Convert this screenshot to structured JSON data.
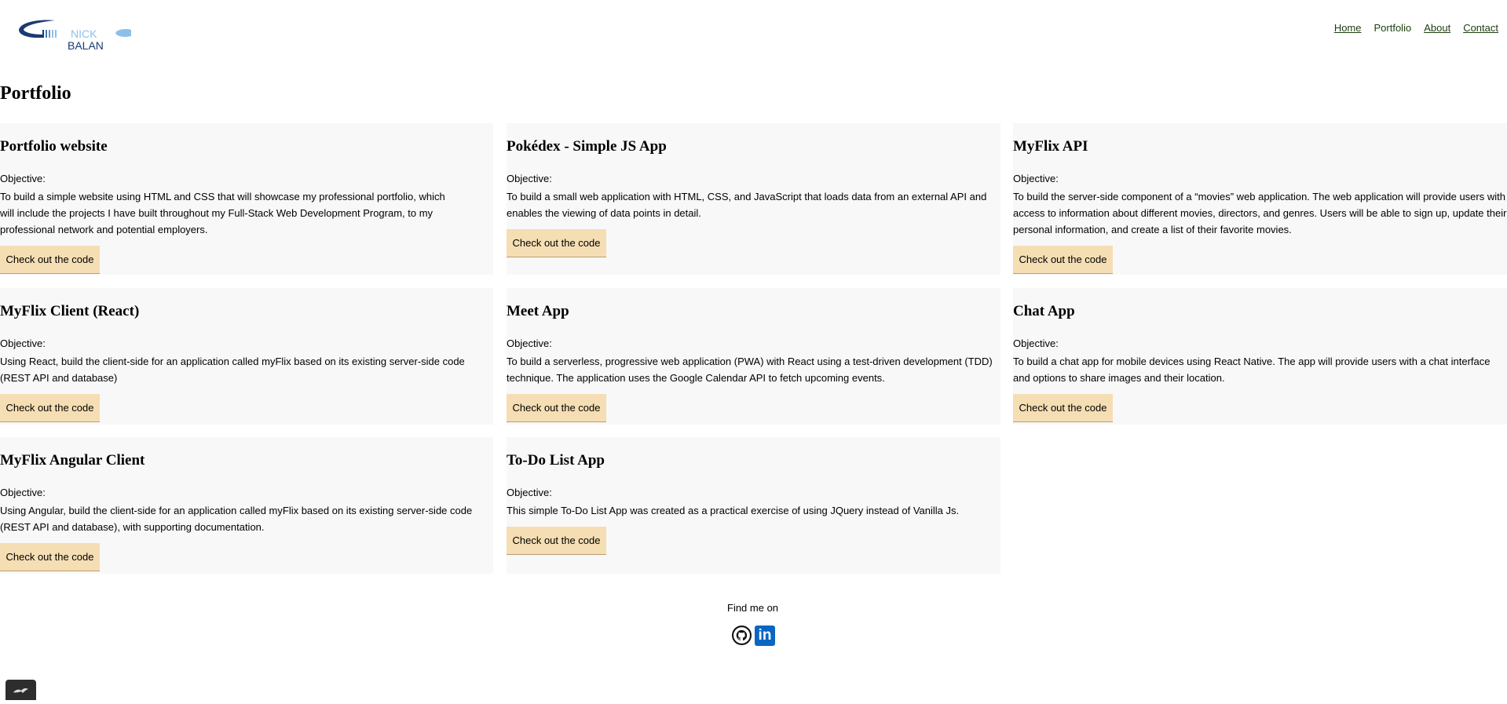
{
  "brand": {
    "first_name": "NICK",
    "last_name": "BALAN",
    "colors": {
      "navy": "#1a3a73",
      "light_blue": "#8cc0ea"
    }
  },
  "nav": {
    "items": [
      {
        "label": "Home",
        "active": false
      },
      {
        "label": "Portfolio",
        "active": true
      },
      {
        "label": "About",
        "active": false
      },
      {
        "label": "Contact",
        "active": false
      }
    ]
  },
  "page_title": "Portfolio",
  "objective_label": "Objective:",
  "button_label": "Check out the code",
  "projects": [
    {
      "title": "Portfolio website",
      "objective": "To build a simple website using HTML and CSS that will showcase my professional portfolio, which will include the projects I have built throughout my Full-Stack Web Development Program, to my professional network and potential employers."
    },
    {
      "title": "Pokédex - Simple JS App",
      "objective": "To build a small web application with HTML, CSS, and JavaScript that loads data from an external API and enables the viewing of data points in detail."
    },
    {
      "title": "MyFlix API",
      "objective": "To build the server-side component of a “movies” web application. The web application will provide users with access to information about different movies, directors, and genres. Users will be able to sign up, update their personal information, and create a list of their favorite movies."
    },
    {
      "title": "MyFlix Client (React)",
      "objective": "Using React, build the client-side for an application called myFlix based on its existing server-side code (REST API and database)"
    },
    {
      "title": "Meet App",
      "objective": "To build a serverless, progressive web application (PWA) with React using a test-driven development (TDD) technique. The application uses the Google Calendar API to fetch upcoming events."
    },
    {
      "title": "Chat App",
      "objective": "To build a chat app for mobile devices using React Native. The app will provide users with a chat interface and options to share images and their location."
    },
    {
      "title": "MyFlix Angular Client",
      "objective": "Using Angular, build the client-side for an application called myFlix based on its existing server-side code (REST API and database), with supporting documentation."
    },
    {
      "title": "To-Do List App",
      "objective": "This simple To-Do List App was created as a practical exercise of using JQuery instead of Vanilla Js."
    }
  ],
  "footer": {
    "label": "Find me on",
    "icons": [
      "github-icon",
      "linkedin-icon"
    ],
    "linkedin_glyph": "in"
  },
  "colors": {
    "card_background": "#f8f8f8",
    "button_background": "#f5deb3",
    "nav_link": "#1d3d10",
    "linkedin_blue": "#0a66c2"
  }
}
